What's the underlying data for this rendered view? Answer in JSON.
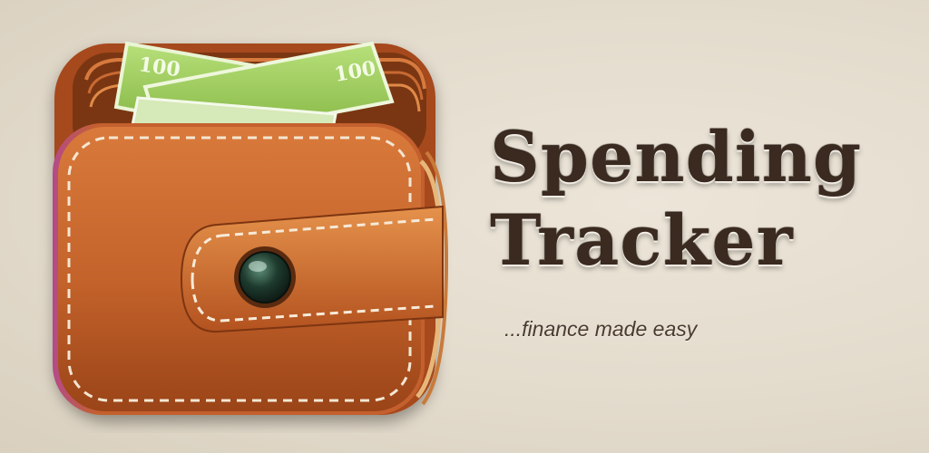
{
  "app": {
    "title_line1": "Spending",
    "title_line2": "Tracker",
    "tagline": "...finance made easy"
  },
  "icon": {
    "name": "wallet-icon",
    "banknote_label_front": "100",
    "banknote_label_back": "100"
  },
  "colors": {
    "background": "#e4dccd",
    "leather": "#c8682e",
    "leather_dark": "#8e3f17",
    "banknote": "#8cc24a",
    "title_text": "#3a2a20",
    "button": "#1f3a2c"
  }
}
